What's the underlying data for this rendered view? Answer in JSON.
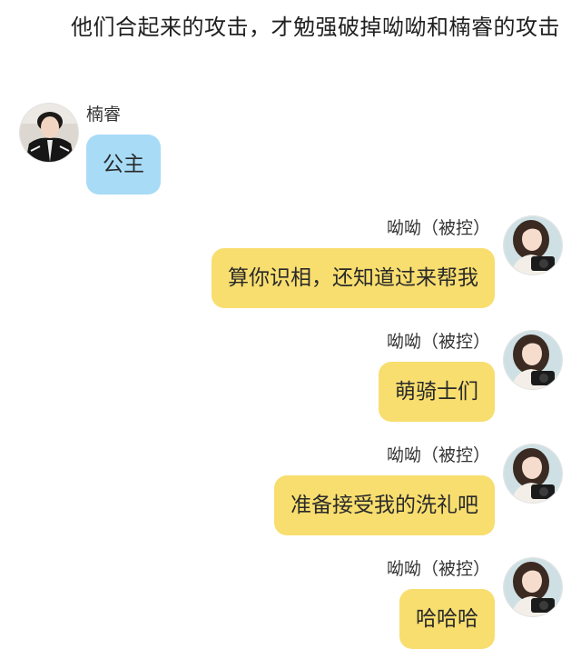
{
  "narration": "他们合起来的攻击，才勉强破掉呦呦和楠睿的攻击",
  "messages": [
    {
      "sender": "楠睿",
      "text": "公主",
      "side": "left",
      "bubble_color": "#a8dbf6"
    },
    {
      "sender": "呦呦（被控）",
      "text": "算你识相，还知道过来帮我",
      "side": "right",
      "bubble_color": "#f8de6f"
    },
    {
      "sender": "呦呦（被控）",
      "text": "萌骑士们",
      "side": "right",
      "bubble_color": "#f8de6f"
    },
    {
      "sender": "呦呦（被控）",
      "text": "准备接受我的洗礼吧",
      "side": "right",
      "bubble_color": "#f8de6f"
    },
    {
      "sender": "呦呦（被控）",
      "text": "哈哈哈",
      "side": "right",
      "bubble_color": "#f8de6f"
    }
  ],
  "avatars": {
    "left": "avatar-boy-black-jacket",
    "right": "avatar-girl-with-camera"
  }
}
